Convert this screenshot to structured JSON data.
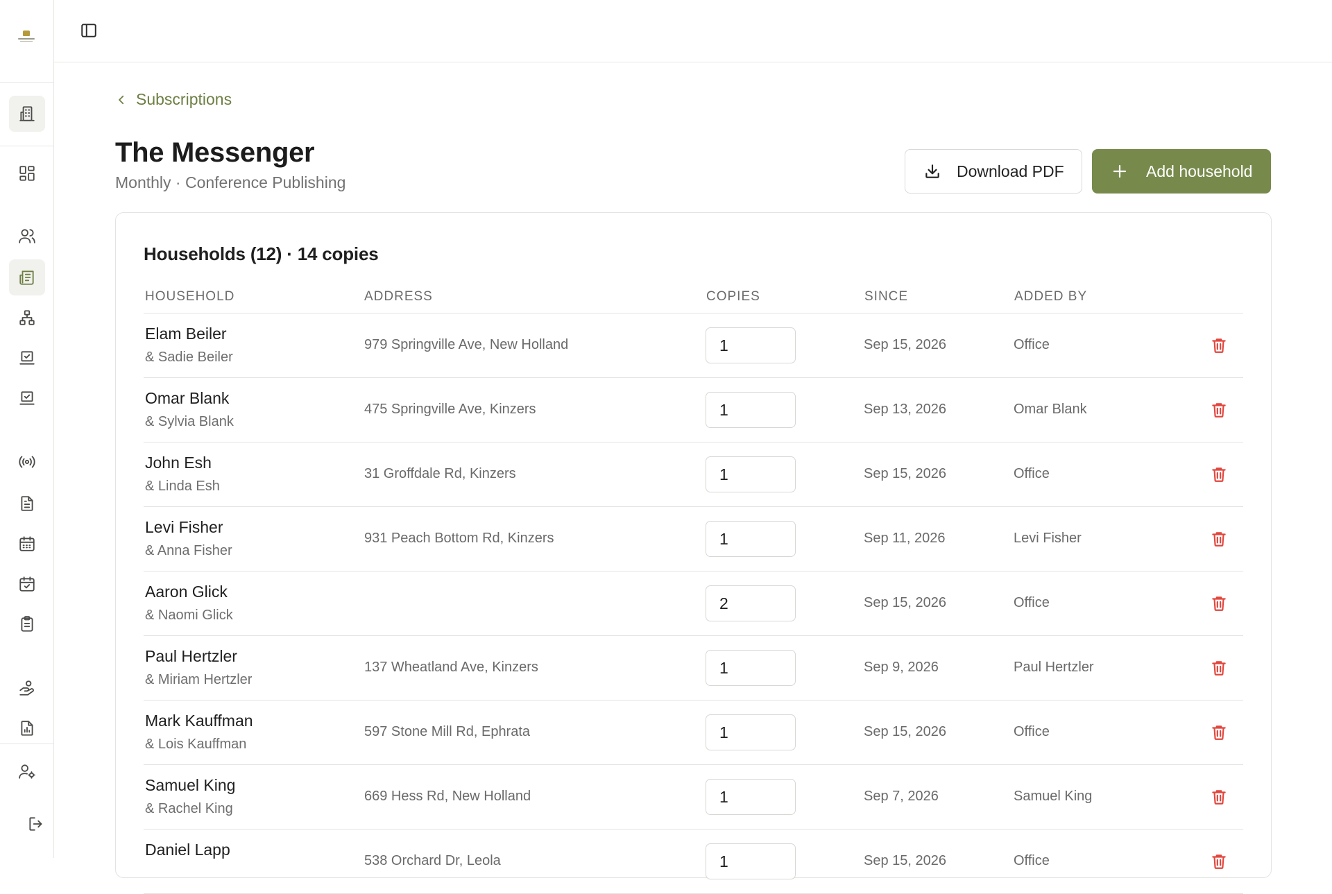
{
  "app": {
    "toggle_sidebar_icon": "panel-left-icon"
  },
  "sidebar": {
    "items": [
      {
        "icon": "building-icon",
        "active": true
      },
      {
        "icon": "dashboard-icon"
      },
      {
        "icon": "users-icon"
      },
      {
        "icon": "newspaper-icon",
        "active": true
      },
      {
        "icon": "org-chart-icon"
      },
      {
        "icon": "laptop-check-icon"
      },
      {
        "icon": "laptop-check-icon"
      },
      {
        "icon": "broadcast-icon"
      },
      {
        "icon": "document-icon"
      },
      {
        "icon": "calendar-icon"
      },
      {
        "icon": "calendar-check-icon"
      },
      {
        "icon": "clipboard-icon"
      },
      {
        "icon": "hand-coins-icon"
      },
      {
        "icon": "report-icon"
      },
      {
        "icon": "user-settings-icon"
      },
      {
        "icon": "logout-icon"
      }
    ]
  },
  "breadcrumb": {
    "back_label": "Subscriptions"
  },
  "header": {
    "title": "The Messenger",
    "subtitle": "Monthly · Conference Publishing",
    "download_label": "Download PDF",
    "add_label": "Add household"
  },
  "households": {
    "title": "Households (12) · 14 copies",
    "columns": {
      "household": "HOUSEHOLD",
      "address": "ADDRESS",
      "copies": "COPIES",
      "since": "SINCE",
      "added_by": "ADDED BY"
    },
    "rows": [
      {
        "name": "Elam Beiler",
        "spouse": "& Sadie Beiler",
        "address": "979 Springville Ave, New Holland",
        "copies": "1",
        "since": "Sep 15, 2026",
        "added_by": "Office"
      },
      {
        "name": "Omar Blank",
        "spouse": "& Sylvia Blank",
        "address": "475 Springville Ave, Kinzers",
        "copies": "1",
        "since": "Sep 13, 2026",
        "added_by": "Omar Blank"
      },
      {
        "name": "John Esh",
        "spouse": "& Linda Esh",
        "address": "31 Groffdale Rd, Kinzers",
        "copies": "1",
        "since": "Sep 15, 2026",
        "added_by": "Office"
      },
      {
        "name": "Levi Fisher",
        "spouse": "& Anna Fisher",
        "address": "931 Peach Bottom Rd, Kinzers",
        "copies": "1",
        "since": "Sep 11, 2026",
        "added_by": "Levi Fisher"
      },
      {
        "name": "Aaron Glick",
        "spouse": "& Naomi Glick",
        "address": "",
        "copies": "2",
        "since": "Sep 15, 2026",
        "added_by": "Office"
      },
      {
        "name": "Paul Hertzler",
        "spouse": "& Miriam Hertzler",
        "address": "137 Wheatland Ave, Kinzers",
        "copies": "1",
        "since": "Sep 9, 2026",
        "added_by": "Paul Hertzler"
      },
      {
        "name": "Mark Kauffman",
        "spouse": "& Lois Kauffman",
        "address": "597 Stone Mill Rd, Ephrata",
        "copies": "1",
        "since": "Sep 15, 2026",
        "added_by": "Office"
      },
      {
        "name": "Samuel King",
        "spouse": "& Rachel King",
        "address": "669 Hess Rd, New Holland",
        "copies": "1",
        "since": "Sep 7, 2026",
        "added_by": "Samuel King"
      },
      {
        "name": "Daniel Lapp",
        "spouse": "",
        "address": "538 Orchard Dr, Leola",
        "copies": "1",
        "since": "Sep 15, 2026",
        "added_by": "Office"
      }
    ]
  }
}
